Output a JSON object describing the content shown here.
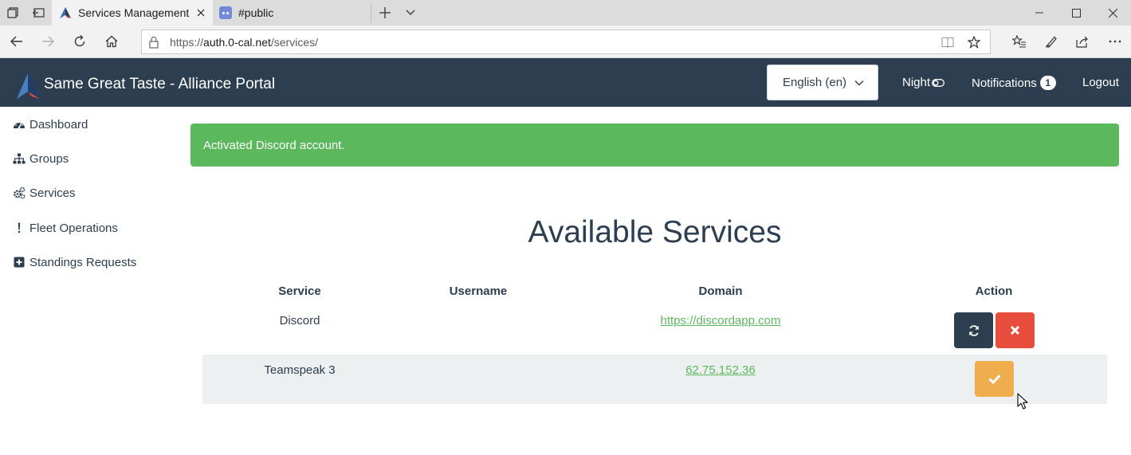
{
  "browser": {
    "tabs": [
      {
        "title": "Services Management -",
        "active": true
      },
      {
        "title": "#public",
        "active": false
      }
    ],
    "url_prefix": "https://",
    "url_host": "auth.0-cal.net",
    "url_path": "/services/"
  },
  "navbar": {
    "brand": "Same Great Taste - Alliance Portal",
    "language": "English (en)",
    "night_label": "Night",
    "notifications_label": "Notifications",
    "notifications_count": "1",
    "logout_label": "Logout"
  },
  "sidebar": {
    "items": [
      {
        "label": "Dashboard",
        "icon": "dashboard-icon"
      },
      {
        "label": "Groups",
        "icon": "sitemap-icon"
      },
      {
        "label": "Services",
        "icon": "cogs-icon"
      },
      {
        "label": "Fleet Operations",
        "icon": "exclamation-icon"
      },
      {
        "label": "Standings Requests",
        "icon": "plus-square-icon"
      }
    ]
  },
  "alert": {
    "message": "Activated Discord account."
  },
  "main": {
    "title": "Available Services",
    "columns": [
      "Service",
      "Username",
      "Domain",
      "Action"
    ],
    "rows": [
      {
        "service": "Discord",
        "username": "",
        "domain": "https://discordapp.com",
        "actions": [
          "refresh",
          "delete"
        ]
      },
      {
        "service": "Teamspeak 3",
        "username": "",
        "domain": "62.75.152.36",
        "actions": [
          "activate"
        ]
      }
    ]
  },
  "colors": {
    "navbar": "#2c3e50",
    "success": "#5cb85c",
    "danger": "#e74c3c",
    "warning": "#f0ad4e",
    "striped_row": "#ecf0f1"
  }
}
